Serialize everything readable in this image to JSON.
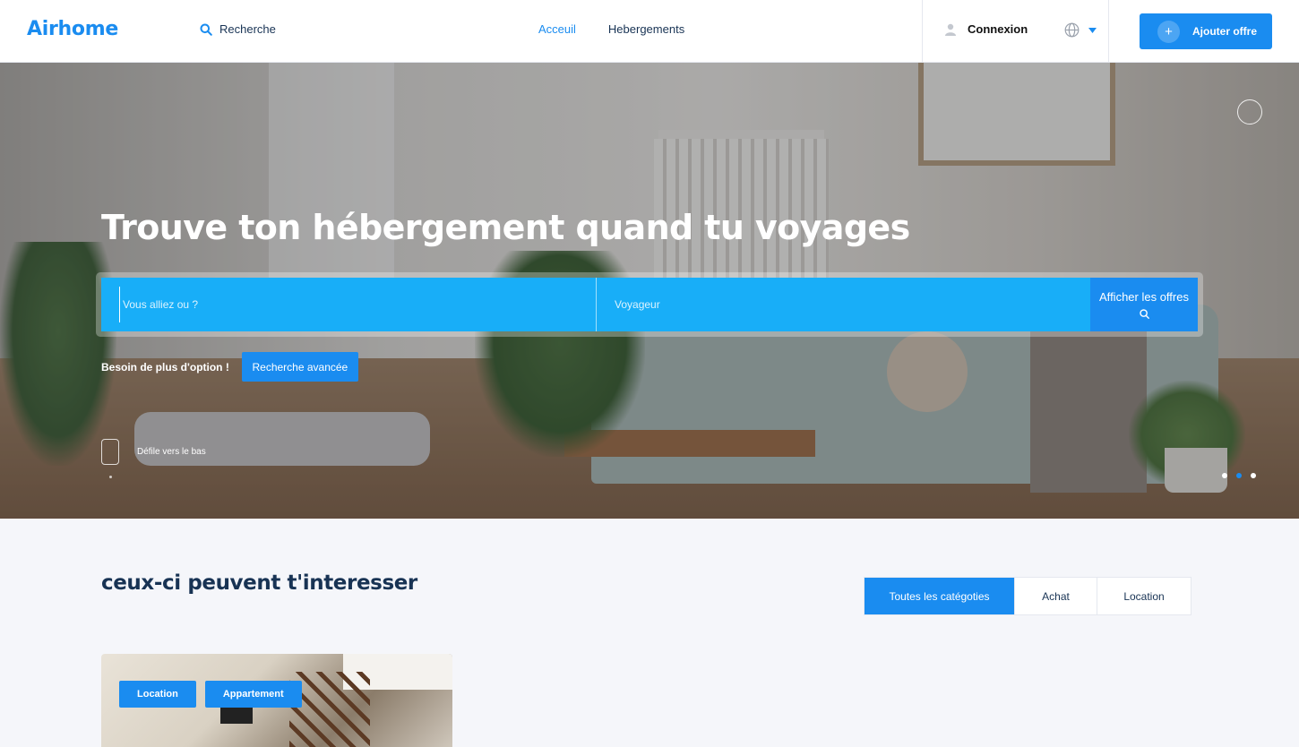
{
  "header": {
    "logo": "Airhome",
    "search_label": "Recherche",
    "nav": [
      {
        "label": "Acceuil"
      },
      {
        "label": "Hebergements"
      }
    ],
    "login_label": "Connexion",
    "add_offer_label": "Ajouter offre",
    "add_offer_icon": "+",
    "accent_color": "#1a8cf0"
  },
  "hero": {
    "title": "Trouve ton hébergement quand tu voyages",
    "search": {
      "where_placeholder": "Vous alliez ou ?",
      "guests_placeholder": "Voyageur",
      "submit_label": "Afficher les offres"
    },
    "more_options_text": "Besoin de plus d'option !",
    "advanced_search_label": "Recherche avancée",
    "scroll_hint": "Défile vers le bas",
    "slider_dots": 3,
    "active_slide": 2
  },
  "section": {
    "title": "ceux-ci peuvent t'interesser",
    "filters": [
      {
        "label": "Toutes les catégoties",
        "active": true
      },
      {
        "label": "Achat",
        "active": false
      },
      {
        "label": "Location",
        "active": false
      }
    ]
  },
  "listing": {
    "tags": [
      "Location",
      "Appartement"
    ]
  }
}
